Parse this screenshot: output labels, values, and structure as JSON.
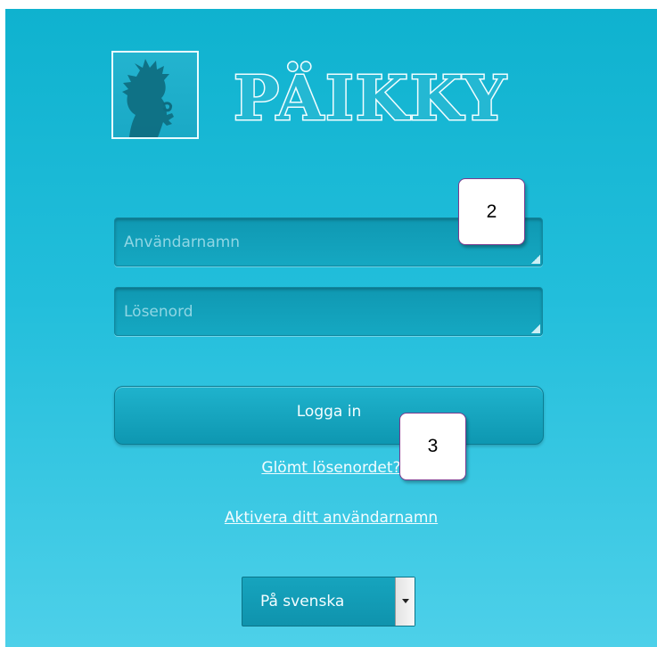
{
  "brand": {
    "name": "PÄIKKY",
    "mascot_icon": "child-silhouette-icon"
  },
  "login": {
    "username_placeholder": "Användarnamn",
    "password_placeholder": "Lösenord",
    "submit_label": "Logga in"
  },
  "links": {
    "forgot_password": "Glömt lösenordet?",
    "activate_username": "Aktivera ditt användarnamn"
  },
  "language": {
    "selected": "På svenska",
    "icon": "chevron-down-icon"
  },
  "annotations": [
    {
      "label": "2"
    },
    {
      "label": "3"
    }
  ],
  "colors": {
    "background": "#22bedb",
    "field": "#15a8c2",
    "button": "#1fb3cd",
    "callout_border": "#7a3a8f"
  }
}
